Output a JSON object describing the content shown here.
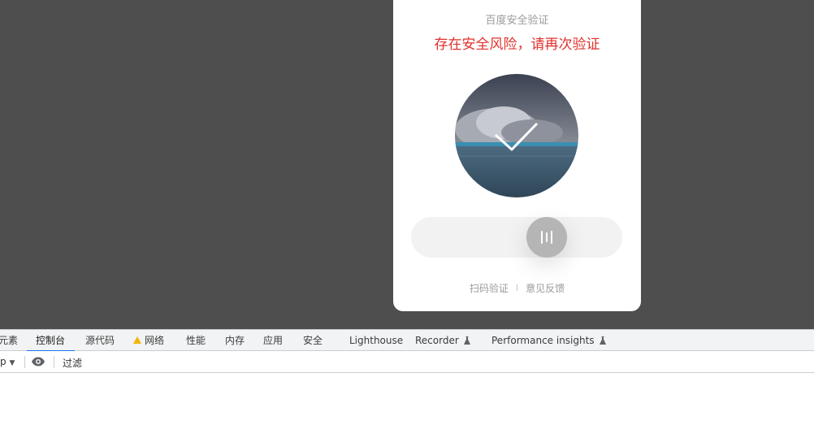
{
  "captcha": {
    "title": "百度安全验证",
    "warning": "存在安全风险，请再次验证",
    "slider_progress": 0.65,
    "links": {
      "scan": "扫码验证",
      "separator": "I",
      "feedback": "意见反馈"
    }
  },
  "devtools": {
    "tabs": [
      {
        "label": "元素",
        "active": false
      },
      {
        "label": "控制台",
        "active": true
      },
      {
        "label": "源代码",
        "active": false
      },
      {
        "label": "网络",
        "active": false,
        "icon": "warning-icon"
      },
      {
        "label": "性能",
        "active": false
      },
      {
        "label": "内存",
        "active": false
      },
      {
        "label": "应用",
        "active": false
      },
      {
        "label": "安全",
        "active": false
      },
      {
        "label": "Lighthouse",
        "active": false
      },
      {
        "label": "Recorder",
        "active": false,
        "icon": "flask-icon"
      },
      {
        "label": "Performance insights",
        "active": false,
        "icon": "flask-icon"
      }
    ],
    "toolbar": {
      "context_text": "p",
      "context_arrow": "▼",
      "filter_placeholder": "过滤"
    }
  },
  "colors": {
    "background": "#4e4e4e",
    "warning_red": "#e0312d",
    "tab_accent": "#1a73e8",
    "warn_yellow": "#f2b600"
  }
}
